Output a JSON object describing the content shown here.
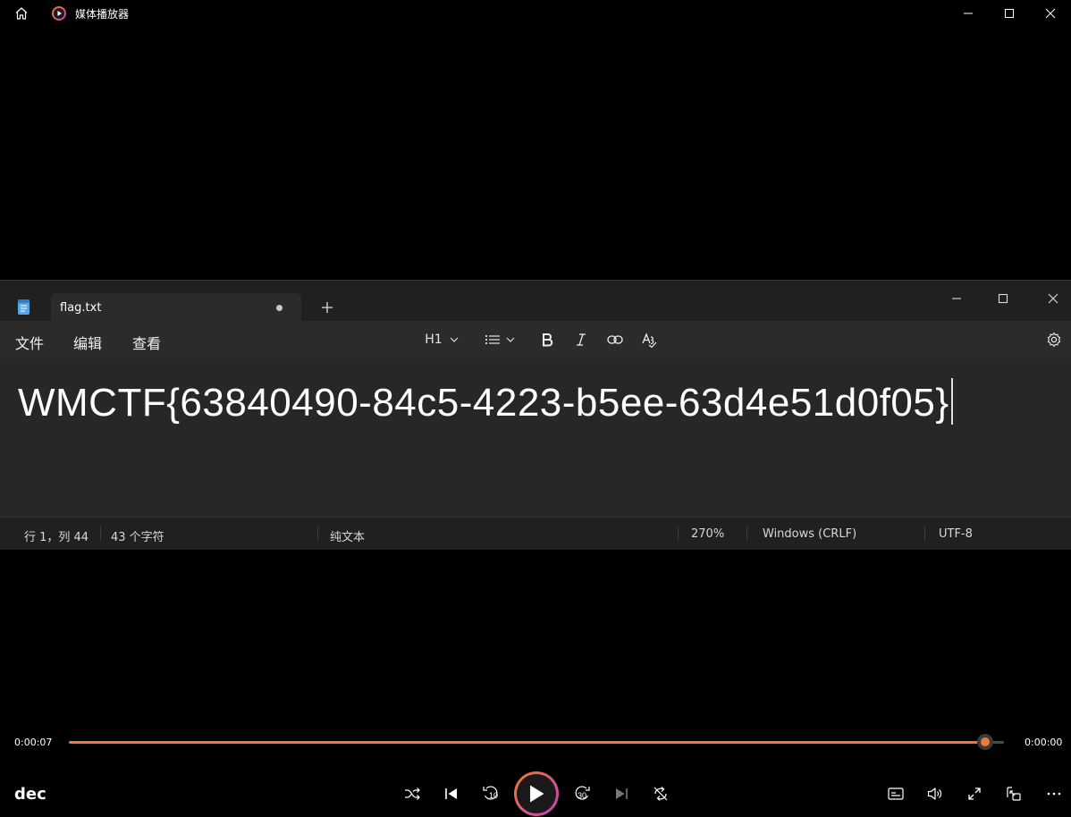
{
  "window": {
    "title": "媒体播放器"
  },
  "notepad": {
    "tab_label": "flag.txt",
    "menu": {
      "file": "文件",
      "edit": "编辑",
      "view": "查看"
    },
    "toolbar": {
      "heading": "H1"
    },
    "content": "WMCTF{63840490-84c5-4223-b5ee-63d4e51d0f05}",
    "status": {
      "position": "行 1，列 44",
      "char_count": "43 个字符",
      "format": "纯文本",
      "zoom": "270%",
      "line_ending": "Windows (CRLF)",
      "encoding": "UTF-8"
    }
  },
  "player": {
    "elapsed": "0:00:07",
    "remaining": "0:00:00",
    "progress_fraction": 0.98,
    "track_name": "dec",
    "rewind_seconds": "10",
    "forward_seconds": "30"
  },
  "colors": {
    "accent": "#f07a32",
    "accent_secondary": "#c23dc0"
  }
}
